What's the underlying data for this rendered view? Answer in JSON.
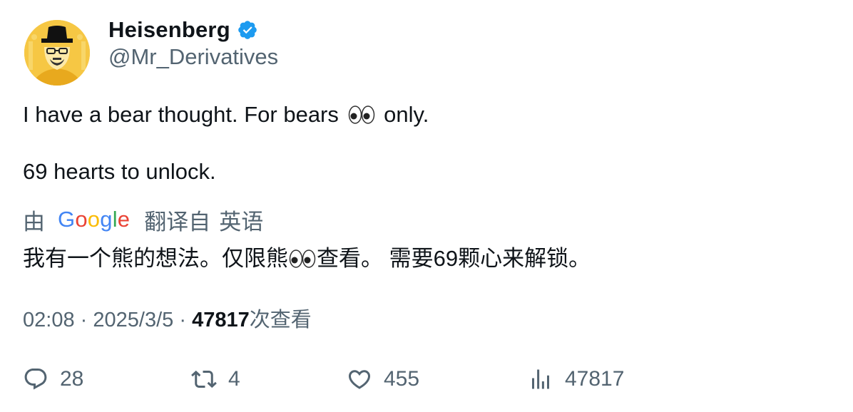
{
  "author": {
    "display_name": "Heisenberg",
    "handle": "@Mr_Derivatives",
    "verified": true,
    "avatar_icon": "heisenberg-avatar"
  },
  "tweet": {
    "line1_before": "I have a bear thought. For bears",
    "line1_after": "only.",
    "line2": "69 hearts to unlock.",
    "emoji": "eyes"
  },
  "translation": {
    "by_label": "由",
    "provider": "Google",
    "translated_from": "翻译自",
    "source_language": "英语",
    "text_before": "我有一个熊的想法。仅限熊",
    "text_after": "查看。 需要69颗心来解锁。"
  },
  "meta": {
    "time": "02:08",
    "separator": "·",
    "date": "2025/3/5",
    "views_count": "47817",
    "views_label": "次查看"
  },
  "actions": {
    "replies": "28",
    "retweets": "4",
    "likes": "455",
    "views": "47817"
  },
  "colors": {
    "text": "#0f1419",
    "secondary": "#536471",
    "verified_blue": "#1d9bf0",
    "avatar_bg": "#f6c744"
  }
}
